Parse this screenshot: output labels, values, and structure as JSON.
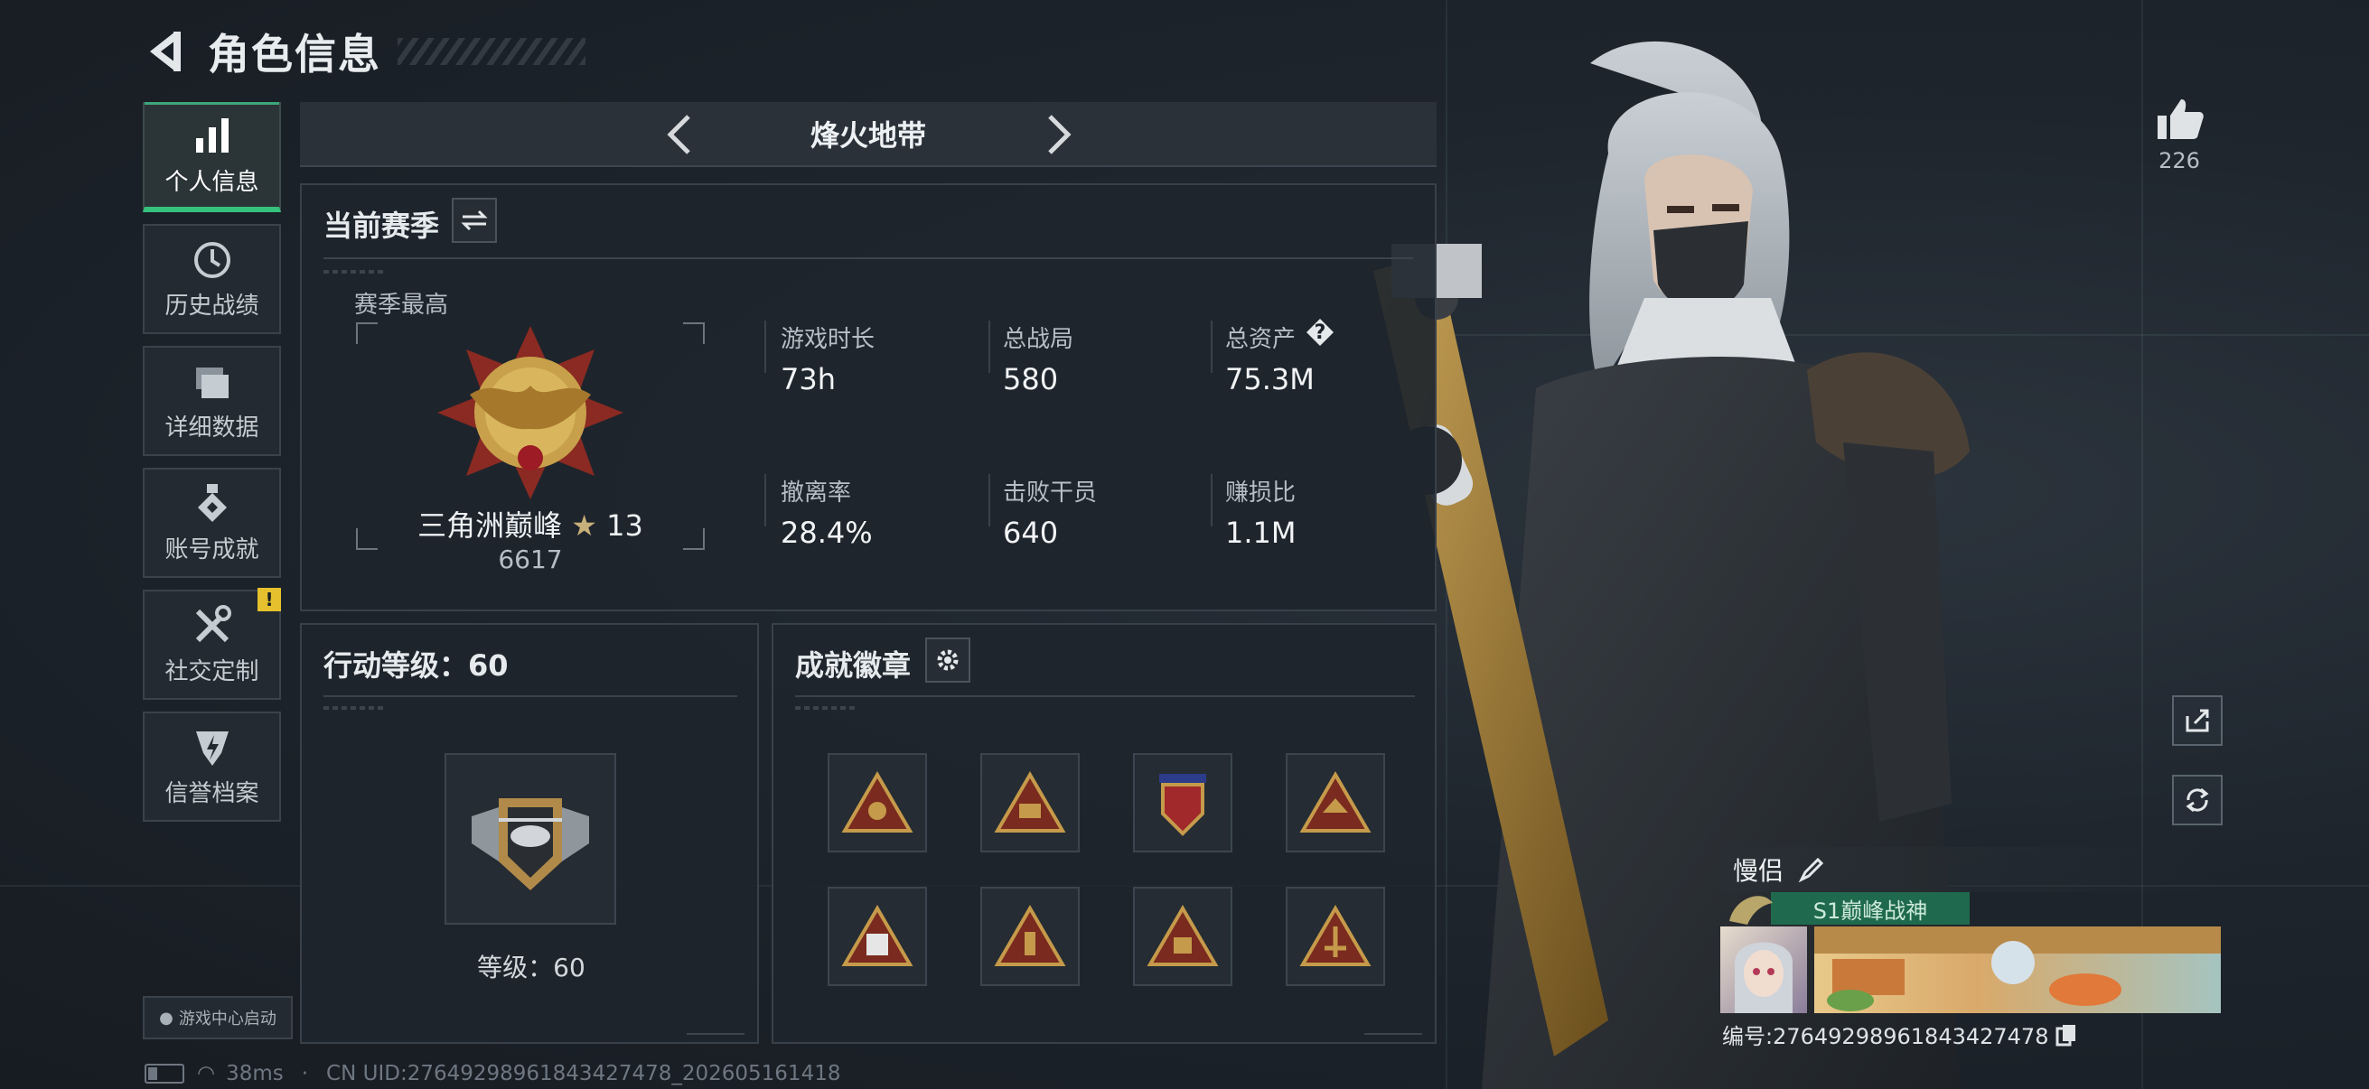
{
  "header": {
    "title": "角色信息"
  },
  "sidebar": {
    "items": [
      {
        "label": "个人信息",
        "icon": "bar-chart-icon"
      },
      {
        "label": "历史战绩",
        "icon": "history-icon"
      },
      {
        "label": "详细数据",
        "icon": "folder-icon"
      },
      {
        "label": "账号成就",
        "icon": "medal-icon"
      },
      {
        "label": "社交定制",
        "icon": "tools-icon"
      },
      {
        "label": "信誉档案",
        "icon": "reputation-icon"
      }
    ],
    "warning_badge": "!",
    "game_center_label": "游戏中心启动"
  },
  "mode_bar": {
    "title": "烽火地带"
  },
  "season": {
    "title": "当前赛季",
    "best_label": "赛季最高",
    "rank_name": "三角洲巅峰",
    "rank_stars": "13",
    "rank_score": "6617",
    "stats": [
      {
        "label": "游戏时长",
        "value": "73h"
      },
      {
        "label": "总战局",
        "value": "580"
      },
      {
        "label": "总资产",
        "value": "75.3M"
      },
      {
        "label": "撤离率",
        "value": "28.4%"
      },
      {
        "label": "击败干员",
        "value": "640"
      },
      {
        "label": "赚损比",
        "value": "1.1M"
      }
    ],
    "help_glyph": "?"
  },
  "action_level": {
    "title": "行动等级：60",
    "level_label": "等级：60"
  },
  "achievements": {
    "title": "成就徽章"
  },
  "profile": {
    "likes": "226",
    "nickname": "慢侣",
    "title_badge": "S1巅峰战神",
    "id_label": "编号:2764929896184342747​8"
  },
  "status": {
    "ping": "38ms",
    "uid": "CN UID:27649298961843427478_202605161418"
  },
  "colors": {
    "accent_green": "#34c27d",
    "warning_yellow": "#e7c12d",
    "background": "#1b2128"
  }
}
